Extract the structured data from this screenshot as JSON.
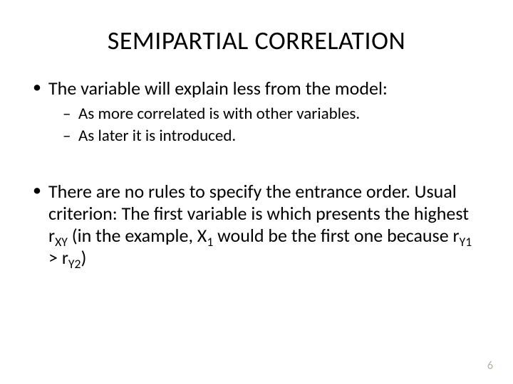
{
  "title": "SEMIPARTIAL CORRELATION",
  "bullets": {
    "b1": "The variable will explain less from the model:",
    "b1a": "As more correlated is with other variables.",
    "b1b": "As later it is introduced.",
    "b2_pre": "There are no rules to specify the entrance order. Usual criterion: The first variable is which presents the highest r",
    "b2_sub1": "XY",
    "b2_mid1": " (in the example, X",
    "b2_sub2": "1",
    "b2_mid2": " would be the first one because r",
    "b2_sub3": "Y1",
    "b2_mid3": " > r",
    "b2_sub4": "Y2",
    "b2_end": ")"
  },
  "page_number": "6"
}
